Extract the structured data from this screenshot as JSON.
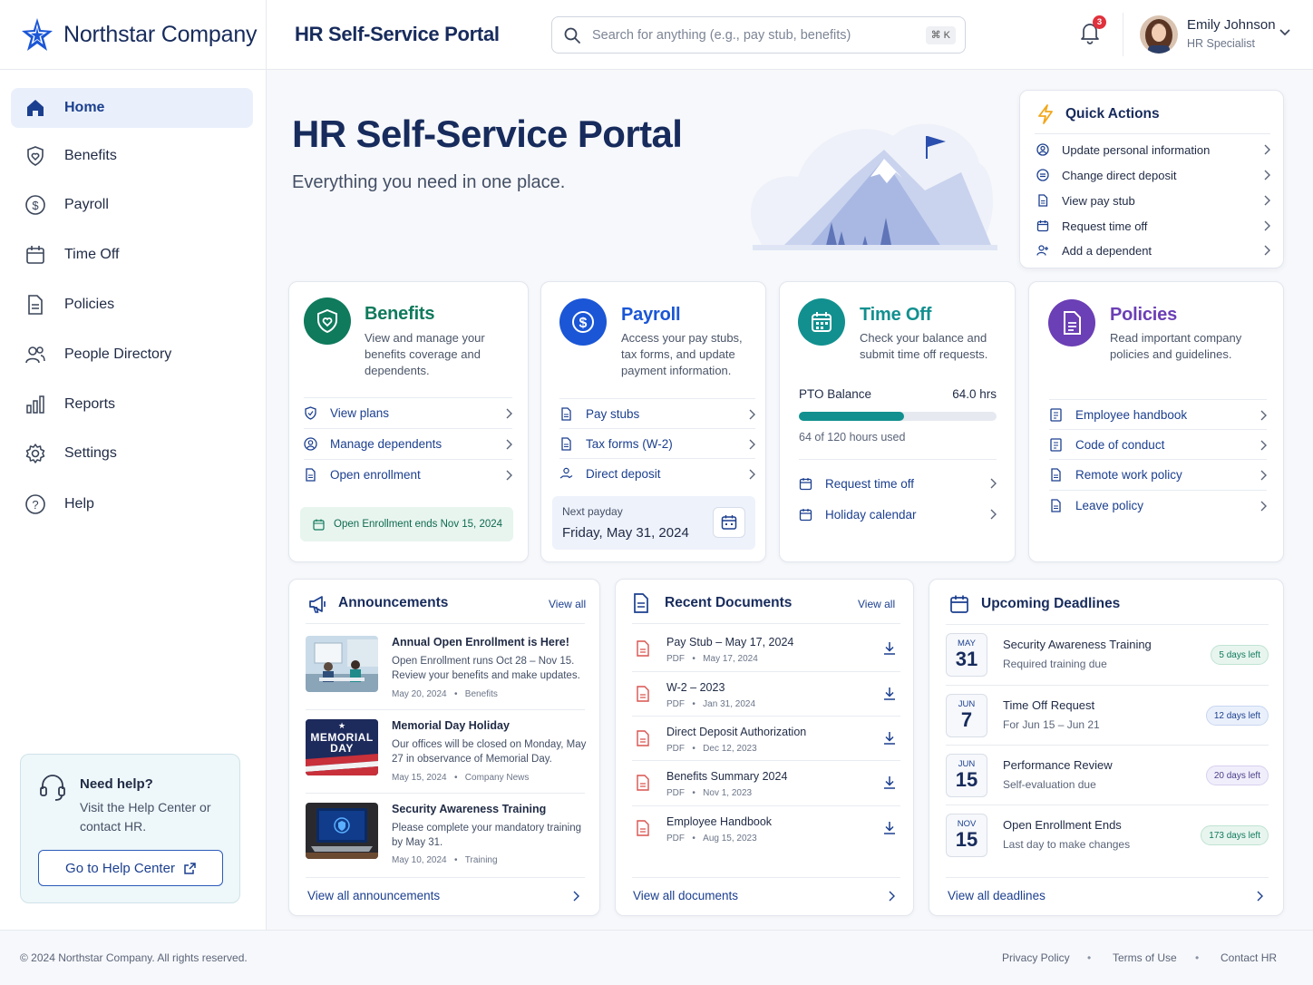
{
  "header": {
    "brand_name": "Northstar Company",
    "portal_title": "HR Self-Service Portal",
    "search_placeholder": "Search for anything (e.g., pay stub, benefits)",
    "search_shortcut": "⌘ K",
    "notification_count": "3",
    "user_name": "Emily Johnson",
    "user_role": "HR Specialist"
  },
  "sidebar": {
    "items": [
      {
        "label": "Home",
        "icon": "home-icon",
        "active": true
      },
      {
        "label": "Benefits",
        "icon": "shield-heart-icon"
      },
      {
        "label": "Payroll",
        "icon": "dollar-circle-icon"
      },
      {
        "label": "Time Off",
        "icon": "calendar-icon"
      },
      {
        "label": "Policies",
        "icon": "document-icon"
      },
      {
        "label": "People Directory",
        "icon": "people-icon"
      },
      {
        "label": "Reports",
        "icon": "bar-chart-icon"
      },
      {
        "label": "Settings",
        "icon": "gear-icon"
      },
      {
        "label": "Help",
        "icon": "question-circle-icon"
      }
    ],
    "help": {
      "title": "Need help?",
      "text": "Visit the Help Center or contact HR.",
      "button": "Go to Help Center"
    }
  },
  "hero": {
    "title": "HR Self-Service Portal",
    "subtitle": "Everything you need in one place."
  },
  "quick_actions": {
    "title": "Quick Actions",
    "items": [
      {
        "label": "Update personal information",
        "icon": "user-circle-icon"
      },
      {
        "label": "Change direct deposit",
        "icon": "deposit-icon"
      },
      {
        "label": "View pay stub",
        "icon": "document-icon"
      },
      {
        "label": "Request time off",
        "icon": "calendar-icon"
      },
      {
        "label": "Add a dependent",
        "icon": "add-user-icon"
      }
    ]
  },
  "cards": {
    "benefits": {
      "title": "Benefits",
      "desc": [
        "View and manage your",
        "benefits coverage and",
        "dependents."
      ],
      "links": [
        "View plans",
        "Manage dependents",
        "Open enrollment"
      ],
      "notice": "Open Enrollment ends Nov 15, 2024",
      "color": "#0f7a5c"
    },
    "payroll": {
      "title": "Payroll",
      "desc": [
        "Access your pay stubs,",
        "tax forms, and update",
        "payment information."
      ],
      "links": [
        "Pay stubs",
        "Tax forms (W-2)",
        "Direct deposit"
      ],
      "next_payday_label": "Next payday",
      "next_payday": "Friday, May 31, 2024",
      "color": "#1a56d6"
    },
    "timeoff": {
      "title": "Time Off",
      "desc": [
        "Check your balance and",
        "submit time off requests."
      ],
      "pto_label": "PTO Balance",
      "pto_value": "64.0 hrs",
      "pto_used_fraction": 0.5333,
      "pto_used_text": "64 of 120 hours used",
      "links": [
        "Request time off",
        "Holiday calendar"
      ],
      "color": "#11908f"
    },
    "policies": {
      "title": "Policies",
      "desc": [
        "Read important company",
        "policies and guidelines."
      ],
      "links": [
        "Employee handbook",
        "Code of conduct",
        "Remote work policy",
        "Leave policy"
      ],
      "color": "#6b3fb5"
    }
  },
  "announcements": {
    "title": "Announcements",
    "view_all": "View all",
    "items": [
      {
        "title": "Annual Open Enrollment is Here!",
        "desc": "Open Enrollment runs Oct 28 – Nov 15. Review your benefits and make updates.",
        "date": "May 20, 2024",
        "tag": "Benefits"
      },
      {
        "title": "Memorial Day Holiday",
        "desc": "Our offices will be closed on Monday, May 27 in observance of Memorial Day.",
        "date": "May 15, 2024",
        "tag": "Company News",
        "thumb_line1": "MEMORIAL",
        "thumb_line2": "DAY"
      },
      {
        "title": "Security Awareness Training",
        "desc": "Please complete your mandatory training by May 31.",
        "date": "May 10, 2024",
        "tag": "Training"
      }
    ],
    "footer_link": "View all announcements"
  },
  "documents": {
    "title": "Recent Documents",
    "view_all": "View all",
    "items": [
      {
        "name": "Pay Stub – May 17, 2024",
        "type": "PDF",
        "date": "May 17, 2024"
      },
      {
        "name": "W-2 – 2023",
        "type": "PDF",
        "date": "Jan 31, 2024"
      },
      {
        "name": "Direct Deposit Authorization",
        "type": "PDF",
        "date": "Dec 12, 2023"
      },
      {
        "name": "Benefits Summary 2024",
        "type": "PDF",
        "date": "Nov 1, 2023"
      },
      {
        "name": "Employee Handbook",
        "type": "PDF",
        "date": "Aug 15, 2023"
      }
    ],
    "footer_link": "View all documents"
  },
  "deadlines": {
    "title": "Upcoming Deadlines",
    "items": [
      {
        "month": "MAY",
        "day": "31",
        "title": "Security Awareness Training",
        "sub": "Required training due",
        "left": "5 days left",
        "tone": "green"
      },
      {
        "month": "JUN",
        "day": "7",
        "title": "Time Off Request",
        "sub": "For Jun 15 – Jun 21",
        "left": "12 days left",
        "tone": "blue"
      },
      {
        "month": "JUN",
        "day": "15",
        "title": "Performance Review",
        "sub": "Self-evaluation due",
        "left": "20 days left",
        "tone": "purple"
      },
      {
        "month": "NOV",
        "day": "15",
        "title": "Open Enrollment Ends",
        "sub": "Last day to make changes",
        "left": "173 days left",
        "tone": "green"
      }
    ],
    "footer_link": "View all deadlines"
  },
  "footer": {
    "copyright": "© 2024 Northstar Company. All rights reserved.",
    "links": [
      "Privacy Policy",
      "Terms of Use",
      "Contact HR"
    ]
  }
}
